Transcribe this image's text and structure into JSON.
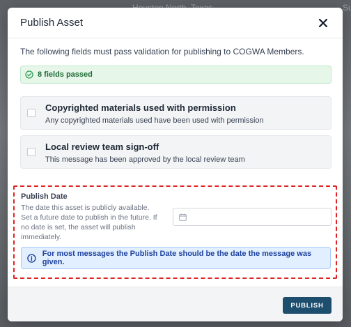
{
  "background": {
    "text_left": "Houston North, Texas",
    "text_right": "Su"
  },
  "modal": {
    "title": "Publish Asset",
    "intro": "The following fields must pass validation for publishing to COGWA Members.",
    "passed_label": "8 fields passed",
    "checks": [
      {
        "title": "Copyrighted materials used with permission",
        "description": "Any copyrighted materials used have been used with permission",
        "checked": false
      },
      {
        "title": "Local review team sign-off",
        "description": "This message has been approved by the local review team",
        "checked": false
      }
    ],
    "publish_date": {
      "label": "Publish Date",
      "description": "The date this asset is publicly available. Set a future date to publish in the future. If no date is set, the asset will publish immediately.",
      "value": "",
      "placeholder": ""
    },
    "info": "For most messages the Publish Date should be the date the message was given.",
    "publish_button": "PUBLISH"
  },
  "colors": {
    "primary_button": "#1e4e6e",
    "success_bg": "#e6f7ea",
    "success_text": "#1f6b34",
    "info_bg": "#e1effe",
    "info_text": "#1e429f",
    "highlight_border": "#e02424"
  },
  "icons": {
    "close": "close-icon",
    "passed": "check-circle-icon",
    "date": "calendar-icon",
    "info": "info-icon"
  }
}
